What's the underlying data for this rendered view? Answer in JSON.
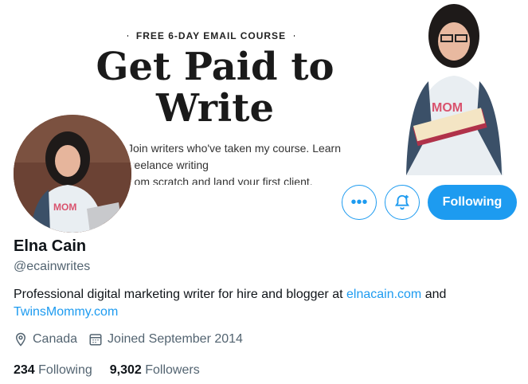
{
  "banner": {
    "kicker": "FREE 6-DAY EMAIL COURSE",
    "headline_line1": "Get Paid to",
    "headline_line2": "Write",
    "subtext_line1": "Join writers who've taken my course. Learn freelance writing",
    "subtext_line2": "from scratch and land your first client."
  },
  "actions": {
    "more_icon": "more-icon",
    "notify_icon": "bell-plus-icon",
    "follow_label": "Following"
  },
  "profile": {
    "name": "Elna Cain",
    "handle": "@ecainwrites",
    "bio_text1": "Professional digital marketing writer for hire and blogger at ",
    "bio_link1": "elnacain.com",
    "bio_text2": " and",
    "bio_link2": "TwinsMommy.com",
    "location": "Canada",
    "joined": "Joined September 2014",
    "following_count": "234",
    "following_label": "Following",
    "followers_count": "9,302",
    "followers_label": "Followers"
  },
  "colors": {
    "accent": "#1d9bf0",
    "text": "#0f1419",
    "muted": "#536471"
  }
}
